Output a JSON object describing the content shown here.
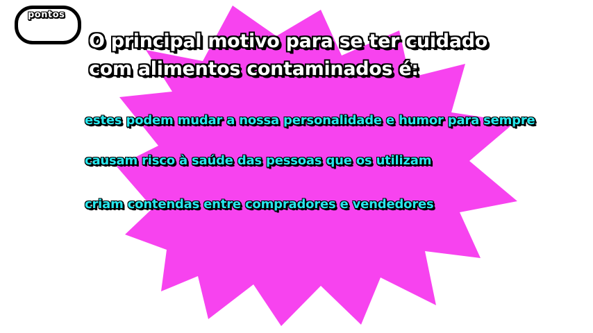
{
  "colors": {
    "burst": "#f743ef",
    "answer_text": "#27e8ee",
    "question_text": "#ffffff",
    "outline": "#000000"
  },
  "score": {
    "label": "pontos"
  },
  "question": {
    "text": "O principal motivo para se ter cuidado com alimentos contaminados é:"
  },
  "answers": [
    {
      "text": "estes podem mudar a nossa personalidade e humor para sempre"
    },
    {
      "text": "causam risco à saúde das pessoas que os utilizam"
    },
    {
      "text": "criam contendas entre compradores e vendedores"
    }
  ]
}
